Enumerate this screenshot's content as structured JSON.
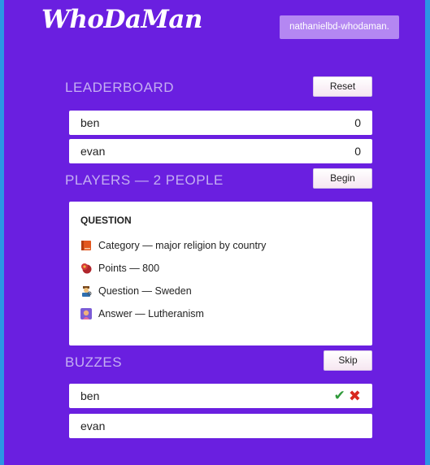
{
  "app": {
    "logo": "WhoDaMan",
    "user": "nathanielbd-whodaman."
  },
  "leaderboard": {
    "title": "LEADERBOARD",
    "reset_label": "Reset",
    "rows": [
      {
        "name": "ben",
        "score": "0"
      },
      {
        "name": "evan",
        "score": "0"
      }
    ]
  },
  "players": {
    "title": "PLAYERS — 2 PEOPLE",
    "begin_label": "Begin"
  },
  "question": {
    "heading": "QUESTION",
    "category": "Category — major religion by country",
    "points": "Points — 800",
    "question": "Question — Sweden",
    "answer": "Answer — Lutheranism"
  },
  "buzzes": {
    "title": "BUZZES",
    "skip_label": "Skip",
    "rows": [
      {
        "name": "ben",
        "check": "✔",
        "cross": "✖"
      },
      {
        "name": "evan"
      }
    ]
  },
  "icons": {
    "category": "book-icon",
    "points": "money-bag-icon",
    "question": "detective-icon",
    "answer": "person-icon"
  }
}
